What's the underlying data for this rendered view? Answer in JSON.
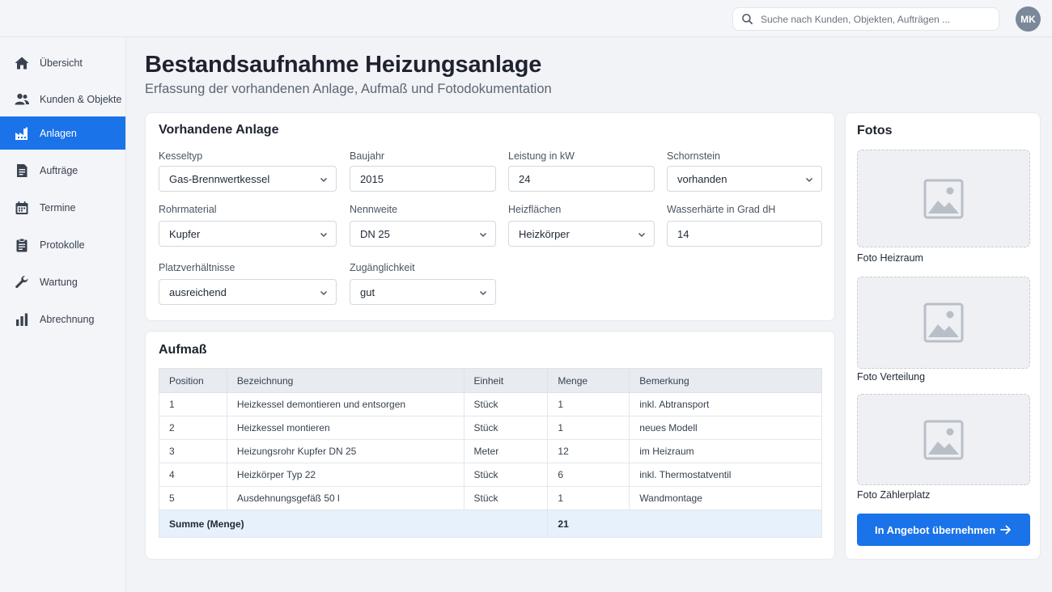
{
  "header": {
    "search_placeholder": "Suche nach Kunden, Objekten, Aufträgen ...",
    "avatar_initials": "MK"
  },
  "sidebar": {
    "items": [
      {
        "label": "Übersicht",
        "icon": "home-icon"
      },
      {
        "label": "Kunden & Objekte",
        "icon": "people-icon"
      },
      {
        "label": "Anlagen",
        "icon": "factory-icon",
        "active": true
      },
      {
        "label": "Aufträge",
        "icon": "document-icon"
      },
      {
        "label": "Termine",
        "icon": "calendar-icon"
      },
      {
        "label": "Protokolle",
        "icon": "clipboard-icon"
      },
      {
        "label": "Wartung",
        "icon": "wrench-icon"
      },
      {
        "label": "Abrechnung",
        "icon": "bar-chart-icon"
      }
    ]
  },
  "page": {
    "title": "Bestandsaufnahme Heizungsanlage",
    "subtitle": "Erfassung der vorhandenen Anlage, Aufmaß und Fotodokumentation"
  },
  "anlage": {
    "title": "Vorhandene Anlage",
    "fields": {
      "kesseltyp": {
        "label": "Kesseltyp",
        "value": "Gas-Brennwertkessel"
      },
      "baujahr": {
        "label": "Baujahr",
        "value": "2015"
      },
      "leistung": {
        "label": "Leistung in kW",
        "value": "24"
      },
      "schornstein": {
        "label": "Schornstein",
        "value": "vorhanden"
      },
      "rohrmaterial": {
        "label": "Rohrmaterial",
        "value": "Kupfer"
      },
      "nennweite": {
        "label": "Nennweite",
        "value": "DN 25"
      },
      "heizflaechen": {
        "label": "Heizflächen",
        "value": "Heizkörper"
      },
      "wasserhaerte": {
        "label": "Wasserhärte in Grad dH",
        "value": "14"
      },
      "platz": {
        "label": "Platzverhältnisse",
        "value": "ausreichend"
      },
      "zugang": {
        "label": "Zugänglichkeit",
        "value": "gut"
      }
    }
  },
  "aufmass": {
    "title": "Aufmaß",
    "columns": [
      "Position",
      "Bezeichnung",
      "Einheit",
      "Menge",
      "Bemerkung"
    ],
    "rows": [
      [
        "1",
        "Heizkessel demontieren und entsorgen",
        "Stück",
        "1",
        "inkl. Abtransport"
      ],
      [
        "2",
        "Heizkessel montieren",
        "Stück",
        "1",
        "neues Modell"
      ],
      [
        "3",
        "Heizungsrohr Kupfer DN 25",
        "Meter",
        "12",
        "im Heizraum"
      ],
      [
        "4",
        "Heizkörper Typ 22",
        "Stück",
        "6",
        "inkl. Thermostatventil"
      ],
      [
        "5",
        "Ausdehnungsgefäß 50 l",
        "Stück",
        "1",
        "Wandmontage"
      ]
    ],
    "sum_label": "Summe (Menge)",
    "sum_value": "21"
  },
  "fotos": {
    "title": "Fotos",
    "items": [
      {
        "label": "Foto Heizraum"
      },
      {
        "label": "Foto Verteilung"
      },
      {
        "label": "Foto Zählerplatz"
      }
    ],
    "button_label": "In Angebot übernehmen"
  }
}
